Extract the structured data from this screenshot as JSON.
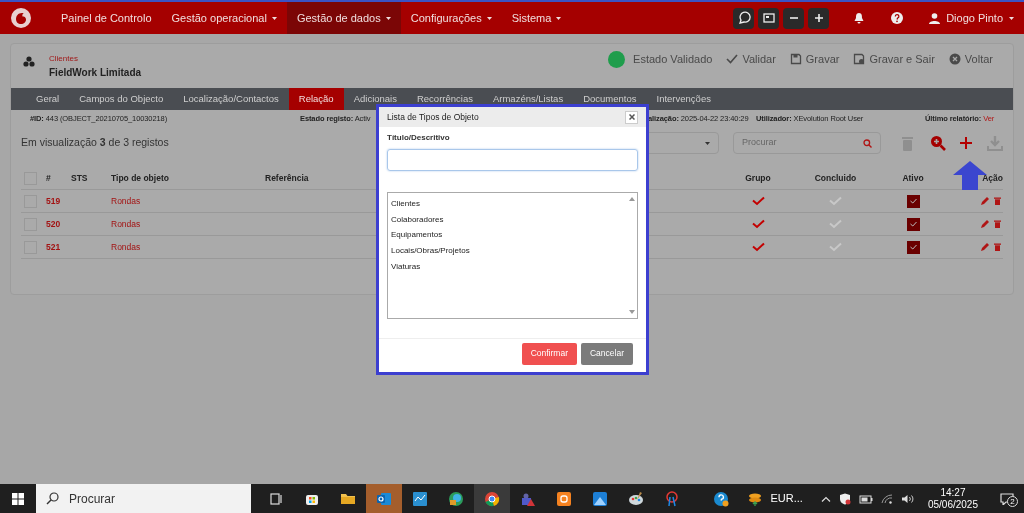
{
  "navbar": {
    "menu": [
      {
        "label": "Painel de Controlo",
        "dropdown": false,
        "selected": false
      },
      {
        "label": "Gestão operacional",
        "dropdown": true,
        "selected": false
      },
      {
        "label": "Gestão de dados",
        "dropdown": true,
        "selected": true
      },
      {
        "label": "Configurações",
        "dropdown": true,
        "selected": false
      },
      {
        "label": "Sistema",
        "dropdown": true,
        "selected": false
      }
    ],
    "user": "Diogo Pinto"
  },
  "record": {
    "entity": "Clientes",
    "name": "FieldWork Limitada",
    "status": "Estado Validado",
    "actions": [
      {
        "label": "Validar",
        "kind": "check"
      },
      {
        "label": "Gravar",
        "kind": "save"
      },
      {
        "label": "Gravar e Sair",
        "kind": "save-exit"
      },
      {
        "label": "Voltar",
        "kind": "back"
      }
    ]
  },
  "tabs": [
    {
      "label": "Geral",
      "selected": false
    },
    {
      "label": "Campos do Objecto",
      "selected": false
    },
    {
      "label": "Localização/Contactos",
      "selected": false
    },
    {
      "label": "Relação",
      "selected": true
    },
    {
      "label": "Adicionais",
      "selected": false
    },
    {
      "label": "Recorrências",
      "selected": false
    },
    {
      "label": "Armazéns/Listas",
      "selected": false
    },
    {
      "label": "Documentos",
      "selected": false
    },
    {
      "label": "Intervenções",
      "selected": false
    }
  ],
  "info": [
    {
      "label": "#ID:",
      "value": "443 (OBJECT_20210705_10030218)",
      "link": false
    },
    {
      "label": "Estado registo:",
      "value": "Activ",
      "link": false
    },
    {
      "label": "alização:",
      "value": "2025-04-22 23:40:29",
      "link": false
    },
    {
      "label": "Utilizador:",
      "value": "XEvolution Root User",
      "link": false
    },
    {
      "label": "Último relatório:",
      "value": "Ver",
      "link": true
    }
  ],
  "list": {
    "summary": "Em visualização **3** de 3 registos",
    "search_placeholder": "Procurar",
    "columns": [
      "#",
      "STS",
      "Tipo de objeto",
      "Referência",
      "Grupo",
      "Concluido",
      "Ativo",
      "Ação"
    ],
    "rows": [
      {
        "checked": false,
        "id": "519",
        "type": "Rondas",
        "grupo": true,
        "concluido": false,
        "ativo": true
      },
      {
        "checked": false,
        "id": "520",
        "type": "Rondas",
        "grupo": true,
        "concluido": false,
        "ativo": true
      },
      {
        "checked": false,
        "id": "521",
        "type": "Rondas",
        "grupo": true,
        "concluido": false,
        "ativo": true
      }
    ],
    "all_checked": false
  },
  "modal": {
    "title": "Lista de Tipos de Objeto",
    "field_label": "Título/Descritivo",
    "options": [
      "Clientes",
      "Colaboradores",
      "Equipamentos",
      "Locais/Obras/Projetos",
      "Viaturas"
    ],
    "buttons": [
      {
        "label": "Confirmar",
        "kind": "primary"
      },
      {
        "label": "Cancelar",
        "kind": "secondary"
      }
    ]
  },
  "taskbar": {
    "search_placeholder": "Procurar",
    "tray_text": "EUR...",
    "time": "14:27",
    "date": "05/06/2025",
    "notification_count": "2"
  }
}
